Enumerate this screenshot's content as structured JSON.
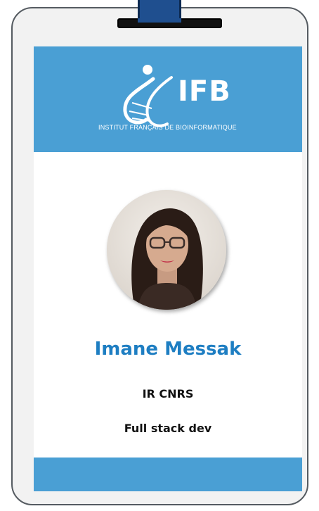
{
  "badge": {
    "logo_name": "IFB",
    "logo_subtitle": "INSTITUT FRANÇAIS DE BIOINFORMATIQUE",
    "person_name": "Imane Messak",
    "position": "IR CNRS",
    "role": "Full stack dev"
  },
  "colors": {
    "banner": "#4a9fd4",
    "name": "#1e7ec2",
    "card_bg": "#f2f2f2",
    "lanyard": "#1f4f8f"
  },
  "icons": {
    "logo_mark": "dna-helix-figure-icon",
    "photo": "profile-photo"
  }
}
